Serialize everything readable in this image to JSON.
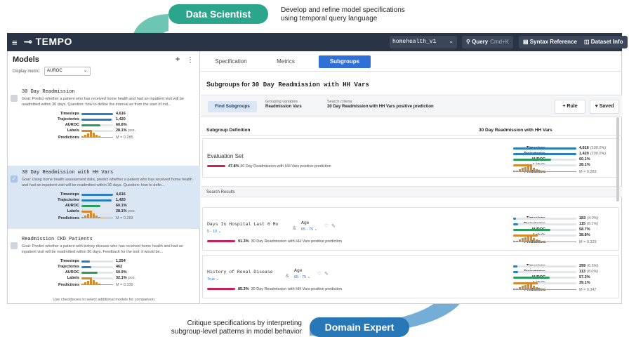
{
  "annotations": {
    "top_role": "Data Scientist",
    "top_desc_line1": "Develop and refine model specifications",
    "top_desc_line2": "using temporal query language",
    "bottom_role": "Domain Expert",
    "bottom_desc_line1": "Critique specifications by interpreting",
    "bottom_desc_line2": "subgroup-level patterns in model behavior"
  },
  "topbar": {
    "app_name": "TEMPO",
    "dataset": "homehealth_v1",
    "query_label": "Query",
    "query_hint": "Cmd+K",
    "syntax_label": "Syntax Reference",
    "dataset_info_label": "Dataset Info"
  },
  "left": {
    "title": "Models",
    "add": "+",
    "more": "⋮",
    "display_metric_label": "Display metric:",
    "display_metric_value": "AUROC",
    "footer": "Use checkboxes to select additional models for comparison.",
    "metric_labels": [
      "Timesteps",
      "Trajectories",
      "AUROC",
      "Labels",
      "Predictions"
    ],
    "models": [
      {
        "name": "30 Day Readmission",
        "goal": "Goal: Predict whether a patient who has received home health and had an inpatient visit will be readmitted within 30 days. Question: how to define the interval as from the start of ind...",
        "timesteps": "4,616",
        "trajectories": "1,420",
        "auroc": "60.8%",
        "labels": "28.1%",
        "labels_suffix": "pos.",
        "predictions": "M = 0.285",
        "timesteps_frac": 1.0,
        "trajectories_frac": 0.95,
        "auroc_frac": 0.6,
        "labels_frac": 0.28
      },
      {
        "name": "30 Day Readmission with HH Vars",
        "goal": "Goal: Using home health assessment data, predict whether a patient who has received home health and had an inpatient visit will be readmitted within 30 days. Question: how to defin...",
        "timesteps": "4,616",
        "trajectories": "1,420",
        "auroc": "60.1%",
        "labels": "28.1%",
        "labels_suffix": "pos.",
        "predictions": "M = 0.283",
        "timesteps_frac": 1.0,
        "trajectories_frac": 0.95,
        "auroc_frac": 0.6,
        "labels_frac": 0.28
      },
      {
        "name": "Readmission CKD Patients",
        "goal": "Goal: Predict whether a patient with kidney disease who has received home health and had an inpatient visit will be readmitted within 30 days. Feedback for the tool: it would be...",
        "timesteps": "1,254",
        "trajectories": "462",
        "auroc": "50.9%",
        "labels": "32.1%",
        "labels_suffix": "pos.",
        "predictions": "M = 0.339",
        "timesteps_frac": 0.27,
        "trajectories_frac": 0.32,
        "auroc_frac": 0.51,
        "labels_frac": 0.32
      }
    ]
  },
  "right": {
    "tabs": [
      "Specification",
      "Metrics",
      "Subgroups"
    ],
    "title_prefix": "Subgroups for",
    "title_model": "30 Day Readmission with HH Vars",
    "find_button": "Find Subgroups",
    "grouping_label": "Grouping variables",
    "grouping_value": "Readmission Vars",
    "criteria_label": "Search criteria",
    "criteria_value": "30 Day Readmission with HH Vars positive prediction",
    "rule_button": "+ Rule",
    "saved_button": "Saved",
    "col_definition": "Subgroup Definition",
    "col_model": "30 Day Readmission with HH Vars",
    "eval_title": "Evaluation Set",
    "eval_pct": "47.8%",
    "eval_text": "30 Day Readmission with HH Vars positive prediction",
    "eval_metrics": {
      "timesteps": "4,616",
      "timesteps_pct": "(100.0%)",
      "trajectories": "1,420",
      "trajectories_pct": "(100.0%)",
      "auroc": "60.1%",
      "labels": "28.1%",
      "predictions": "M = 0.283"
    },
    "search_results_label": "Search Results",
    "results": [
      {
        "var1": "Days In Hospital Last 6 Mo",
        "val1": "5 - 10 ⌄",
        "var2": "Age",
        "val2": "65 - 75 ⌄",
        "pct": "91.3%",
        "text": "30 Day Readmission with HH Vars positive prediction",
        "timesteps": "183",
        "timesteps_pct": "(4.0%)",
        "trajectories": "115",
        "trajectories_pct": "(8.1%)",
        "auroc": "58.7%",
        "labels": "38.8%",
        "predictions": "M = 0.329",
        "timesteps_frac": 0.04,
        "trajectories_frac": 0.08,
        "auroc_frac": 0.587,
        "labels_frac": 0.388
      },
      {
        "var1": "History of Renal Disease",
        "val1": "True ⌄",
        "var2": "Age",
        "val2": "65 - 75 ⌄",
        "pct": "85.3%",
        "text": "30 Day Readmission with HH Vars positive prediction",
        "timesteps": "299",
        "timesteps_pct": "(6.5%)",
        "trajectories": "113",
        "trajectories_pct": "(8.0%)",
        "auroc": "57.3%",
        "labels": "39.1%",
        "predictions": "M = 0.347",
        "timesteps_frac": 0.065,
        "trajectories_frac": 0.08,
        "auroc_frac": 0.573,
        "labels_frac": 0.391
      }
    ],
    "amp": "&"
  },
  "colors": {
    "timesteps": "#2a7fc0",
    "trajectories": "#2a7fc0",
    "auroc": "#2a9d5c",
    "labels": "#d58a2e",
    "perf": "#c9205a",
    "active_tab": "#2f6fd6"
  }
}
